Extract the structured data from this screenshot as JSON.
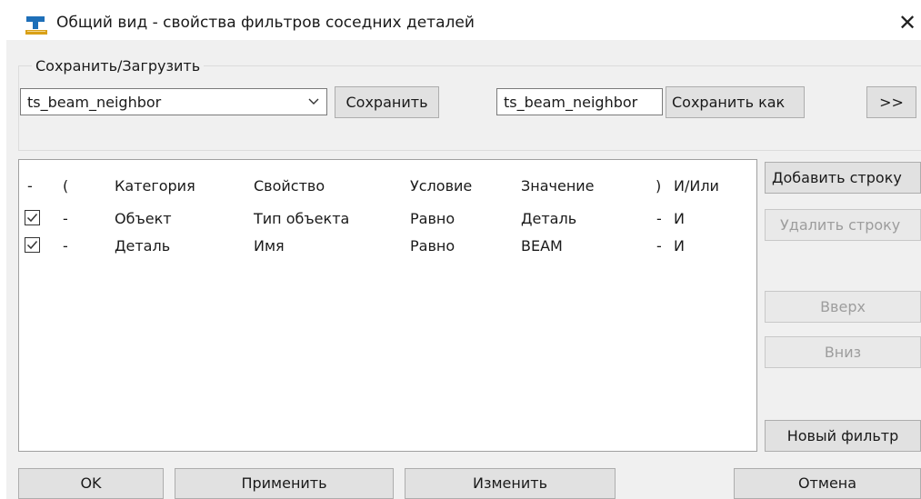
{
  "window": {
    "title": "Общий вид - свойства фильтров соседних деталей",
    "close_glyph": "✕"
  },
  "save_load": {
    "group_label": "Сохранить/Загрузить",
    "preset_selected": "ts_beam_neighbor",
    "save_label": "Сохранить",
    "save_as_value": "ts_beam_neighbor",
    "save_as_label": "Сохранить как",
    "expand_label": ">>"
  },
  "table": {
    "headers": [
      "-",
      "(",
      "Категория",
      "Свойство",
      "Условие",
      "Значение",
      ")",
      "И/Или"
    ],
    "rows": [
      {
        "checked": true,
        "open": "-",
        "category": "Объект",
        "property": "Тип объекта",
        "condition": "Равно",
        "value": "Деталь",
        "close": "-",
        "andor": "И"
      },
      {
        "checked": true,
        "open": "-",
        "category": "Деталь",
        "property": "Имя",
        "condition": "Равно",
        "value": "BEAM",
        "close": "-",
        "andor": "И"
      }
    ]
  },
  "side_buttons": {
    "add_row": "Добавить строку",
    "delete_row": "Удалить строку",
    "up": "Вверх",
    "down": "Вниз",
    "new_filter": "Новый фильтр"
  },
  "footer": {
    "ok": "OK",
    "apply": "Применить",
    "modify": "Изменить",
    "cancel": "Отмена"
  },
  "colors": {
    "dialog_bg": "#f0f0f0",
    "button_bg": "#e1e1e1",
    "disabled_text": "#9d9d9d",
    "icon_blue": "#1e6fb8",
    "icon_gold": "#d9a016"
  },
  "icons": {
    "app": "tekla-view-icon",
    "combo_arrow": "chevron-down-icon",
    "row_checkbox": "checkbox-checked-icon"
  }
}
